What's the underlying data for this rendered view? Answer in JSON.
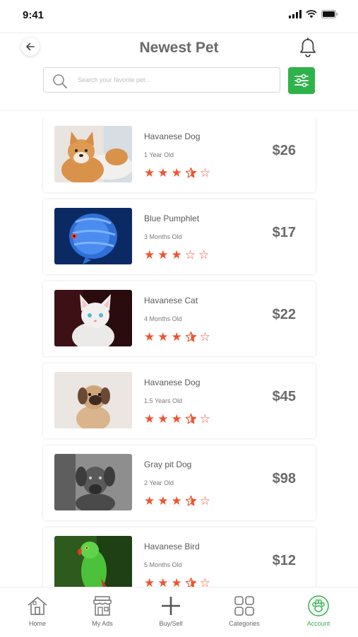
{
  "status": {
    "time": "9:41"
  },
  "header": {
    "title": "Newest Pet"
  },
  "search": {
    "placeholder": "Search your favorite pet..."
  },
  "pets": [
    {
      "name": "Havanese Dog",
      "age": "1 Year Old",
      "price": "$26",
      "rating": 3.5,
      "image": "shiba-dog"
    },
    {
      "name": "Blue Pumphlet",
      "age": "3 Months Old",
      "price": "$17",
      "rating": 3,
      "image": "blue-fish"
    },
    {
      "name": "Havanese Cat",
      "age": "4 Months Old",
      "price": "$22",
      "rating": 3.5,
      "image": "white-kitten"
    },
    {
      "name": "Havanese Dog",
      "age": "1.5 Years Old",
      "price": "$45",
      "rating": 3.5,
      "image": "pug-dog"
    },
    {
      "name": "Gray pit Dog",
      "age": "2 Year Old",
      "price": "$98",
      "rating": 3.5,
      "image": "gray-dog"
    },
    {
      "name": "Havanese Bird",
      "age": "5 Months Old",
      "price": "$12",
      "rating": 3.5,
      "image": "green-parrot"
    }
  ],
  "tabs": [
    {
      "label": "Home",
      "icon": "home-icon"
    },
    {
      "label": "My Ads",
      "icon": "shop-icon"
    },
    {
      "label": "Buy/Sell",
      "icon": "plus-icon"
    },
    {
      "label": "Categories",
      "icon": "grid-icon"
    },
    {
      "label": "Account",
      "icon": "paw-icon",
      "active": true
    }
  ],
  "colors": {
    "accent": "#2eb34a",
    "star": "#f0532d",
    "title": "#6a6a6a"
  }
}
